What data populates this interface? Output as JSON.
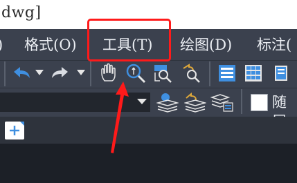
{
  "window": {
    "title": "dwg]"
  },
  "menu": {
    "items": [
      {
        "label": ")"
      },
      {
        "label": "格式(O)"
      },
      {
        "label": "工具(T)"
      },
      {
        "label": "绘图(D)"
      },
      {
        "label": "标注("
      }
    ]
  },
  "toolbar": {
    "layer_color_label": "随层"
  },
  "colors": {
    "menubar_bg": "#3b414e",
    "highlight": "#ff1a1a",
    "accent_blue": "#3f8fe0"
  }
}
